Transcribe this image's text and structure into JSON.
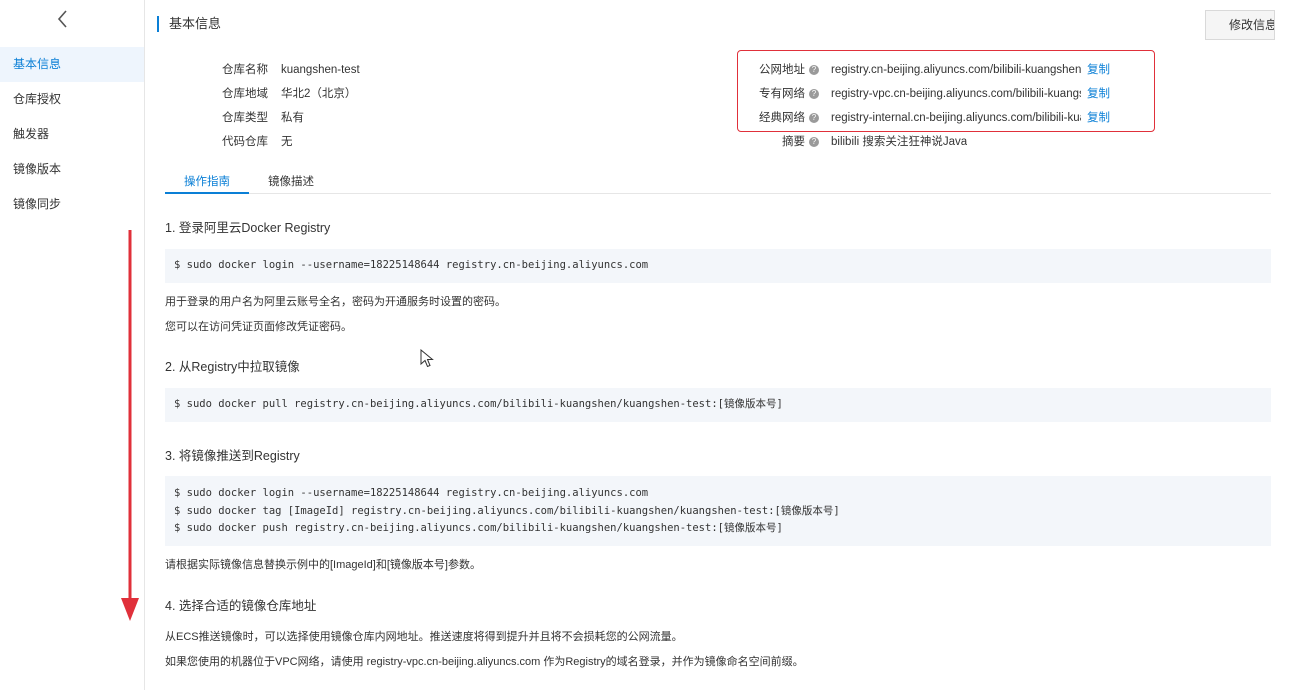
{
  "sidebar": {
    "back_icon": "chevron-left-icon",
    "items": [
      {
        "label": "基本信息",
        "active": true
      },
      {
        "label": "仓库授权",
        "active": false
      },
      {
        "label": "触发器",
        "active": false
      },
      {
        "label": "镜像版本",
        "active": false
      },
      {
        "label": "镜像同步",
        "active": false
      }
    ]
  },
  "header": {
    "title": "基本信息",
    "edit_button": "修改信息"
  },
  "info_left": [
    {
      "label": "仓库名称",
      "value": "kuangshen-test"
    },
    {
      "label": "仓库地域",
      "value": "华北2（北京）"
    },
    {
      "label": "仓库类型",
      "value": "私有"
    },
    {
      "label": "代码仓库",
      "value": "无"
    }
  ],
  "info_right": [
    {
      "label": "公网地址",
      "value": "registry.cn-beijing.aliyuncs.com/bilibili-kuangshen/kuangshen-test",
      "copy": "复制"
    },
    {
      "label": "专有网络",
      "value": "registry-vpc.cn-beijing.aliyuncs.com/bilibili-kuangshen/kuangshen-test",
      "copy": "复制"
    },
    {
      "label": "经典网络",
      "value": "registry-internal.cn-beijing.aliyuncs.com/bilibili-kuangshen/kuangshen-test",
      "copy": "复制"
    },
    {
      "label": "摘要",
      "value": "bilibili 搜索关注狂神说Java"
    }
  ],
  "tabs": [
    {
      "label": "操作指南",
      "active": true
    },
    {
      "label": "镜像描述",
      "active": false
    }
  ],
  "steps": {
    "s1_title": "1. 登录阿里云Docker Registry",
    "s1_code": [
      "$ sudo docker login --username=18225148644 registry.cn-beijing.aliyuncs.com"
    ],
    "s1_note1": "用于登录的用户名为阿里云账号全名，密码为开通服务时设置的密码。",
    "s1_note2": "您可以在访问凭证页面修改凭证密码。",
    "s2_title": "2. 从Registry中拉取镜像",
    "s2_code": [
      "$ sudo docker pull registry.cn-beijing.aliyuncs.com/bilibili-kuangshen/kuangshen-test:[镜像版本号]"
    ],
    "s3_title": "3. 将镜像推送到Registry",
    "s3_code": [
      "$ sudo docker login --username=18225148644 registry.cn-beijing.aliyuncs.com",
      "$ sudo docker tag [ImageId] registry.cn-beijing.aliyuncs.com/bilibili-kuangshen/kuangshen-test:[镜像版本号]",
      "$ sudo docker push registry.cn-beijing.aliyuncs.com/bilibili-kuangshen/kuangshen-test:[镜像版本号]"
    ],
    "s3_note": "请根据实际镜像信息替换示例中的[ImageId]和[镜像版本号]参数。",
    "s4_title": "4. 选择合适的镜像仓库地址",
    "s4_note1": "从ECS推送镜像时，可以选择使用镜像仓库内网地址。推送速度将得到提升并且将不会损耗您的公网流量。",
    "s4_note2": "如果您使用的机器位于VPC网络，请使用 registry-vpc.cn-beijing.aliyuncs.com 作为Registry的域名登录，并作为镜像命名空间前缀。"
  },
  "colors": {
    "accent": "#0a7fd6",
    "annotation_red": "#e0303a",
    "code_bg": "#f3f6fa"
  }
}
